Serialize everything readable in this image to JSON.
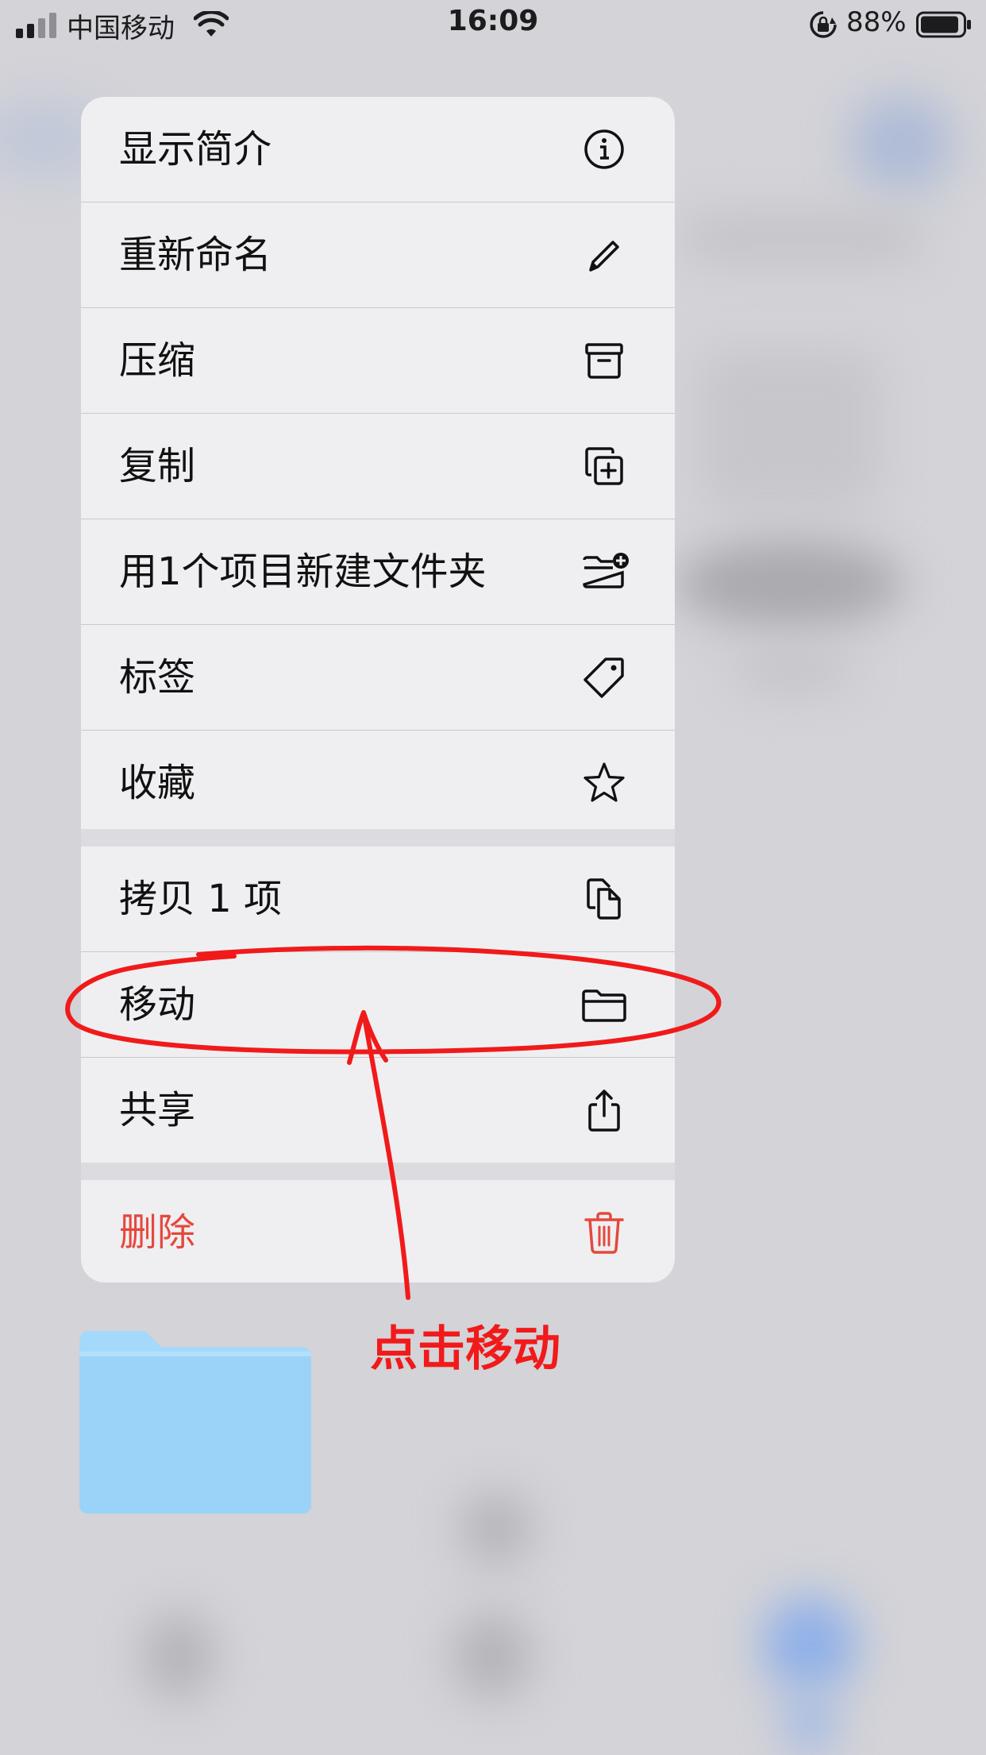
{
  "status_bar": {
    "carrier": "中国移动",
    "time": "16:09",
    "battery": "88%"
  },
  "menu": {
    "items": [
      {
        "label": "显示简介",
        "icon": "info-circle-icon"
      },
      {
        "label": "重新命名",
        "icon": "pencil-icon"
      },
      {
        "label": "压缩",
        "icon": "archive-box-icon"
      },
      {
        "label": "复制",
        "icon": "duplicate-plus-icon"
      },
      {
        "label": "用1个项目新建文件夹",
        "icon": "folder-badge-plus-icon"
      },
      {
        "label": "标签",
        "icon": "tag-icon"
      },
      {
        "label": "收藏",
        "icon": "star-icon"
      },
      {
        "label": "拷贝 1 项",
        "icon": "copy-documents-icon"
      },
      {
        "label": "移动",
        "icon": "folder-icon"
      },
      {
        "label": "共享",
        "icon": "share-icon"
      },
      {
        "label": "删除",
        "icon": "trash-icon"
      }
    ]
  },
  "annotation": {
    "text": "点击移动",
    "color": "#f11a1a"
  },
  "colors": {
    "destructive": "#e5483c",
    "folder": "#9fd6f8"
  }
}
